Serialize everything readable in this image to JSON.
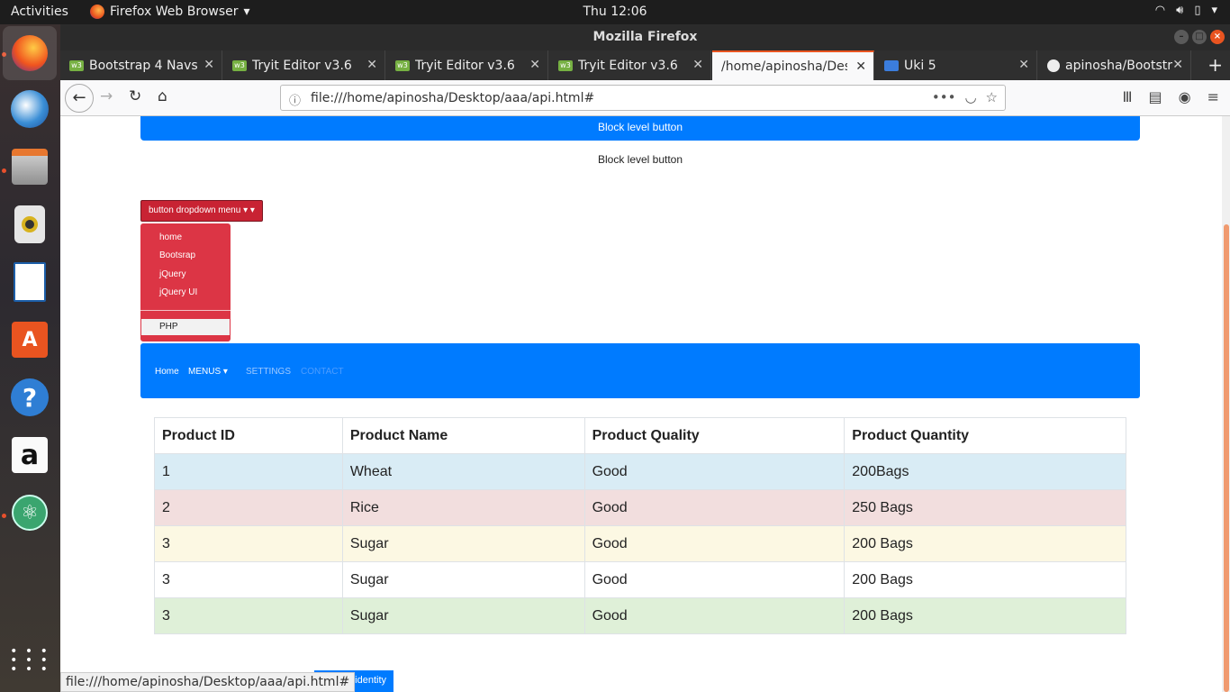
{
  "topbar": {
    "activities": "Activities",
    "app_menu": "Firefox Web Browser",
    "clock": "Thu 12:06"
  },
  "dock": {
    "items": [
      "firefox",
      "thunderbird",
      "files",
      "rhythmbox",
      "writer",
      "software-center",
      "help",
      "amazon",
      "atom",
      "show-apps"
    ]
  },
  "window": {
    "title": "Mozilla Firefox"
  },
  "tabs": [
    {
      "label": "Bootstrap 4 Navs",
      "icon": "w3-icon"
    },
    {
      "label": "Tryit Editor v3.6",
      "icon": "w3-icon"
    },
    {
      "label": "Tryit Editor v3.6",
      "icon": "w3-icon"
    },
    {
      "label": "Tryit Editor v3.6",
      "icon": "w3-icon"
    },
    {
      "label": "/home/apinosha/Des",
      "icon": "none",
      "active": true
    },
    {
      "label": "Uki 5",
      "icon": "contact-icon"
    },
    {
      "label": "apinosha/Bootstr",
      "icon": "github-icon"
    }
  ],
  "urlbar": {
    "url": "file:///home/apinosha/Desktop/aaa/api.html#"
  },
  "page": {
    "block_button_primary": "Block level button",
    "block_button_light": "Block level button",
    "dropdown": {
      "label": "button dropdown menu",
      "items": [
        "home",
        "Bootsrap",
        "jQuery",
        "jQuery UI"
      ],
      "active_item": "PHP"
    },
    "nav": {
      "home": "Home",
      "menus": "MENUS",
      "settings": "SETTINGS",
      "contact": "CONTACT"
    },
    "table": {
      "headers": [
        "Product ID",
        "Product Name",
        "Product Quality",
        "Product Quantity"
      ],
      "rows": [
        {
          "style": "info",
          "cells": [
            "1",
            "Wheat",
            "Good",
            "200Bags"
          ]
        },
        {
          "style": "danger",
          "cells": [
            "2",
            "Rice",
            "Good",
            "250 Bags"
          ]
        },
        {
          "style": "warning",
          "cells": [
            "3",
            "Sugar",
            "Good",
            "200 Bags"
          ]
        },
        {
          "style": "default",
          "cells": [
            "3",
            "Sugar",
            "Good",
            "200 Bags"
          ]
        },
        {
          "style": "success",
          "cells": [
            "3",
            "Sugar",
            "Good",
            "200 Bags"
          ]
        }
      ]
    },
    "identity_button": "identity"
  },
  "statusbar": {
    "text": "file:///home/apinosha/Desktop/aaa/api.html#"
  },
  "colors": {
    "primary": "#007bff",
    "danger": "#dc3545",
    "ubuntu_orange": "#e95420"
  }
}
